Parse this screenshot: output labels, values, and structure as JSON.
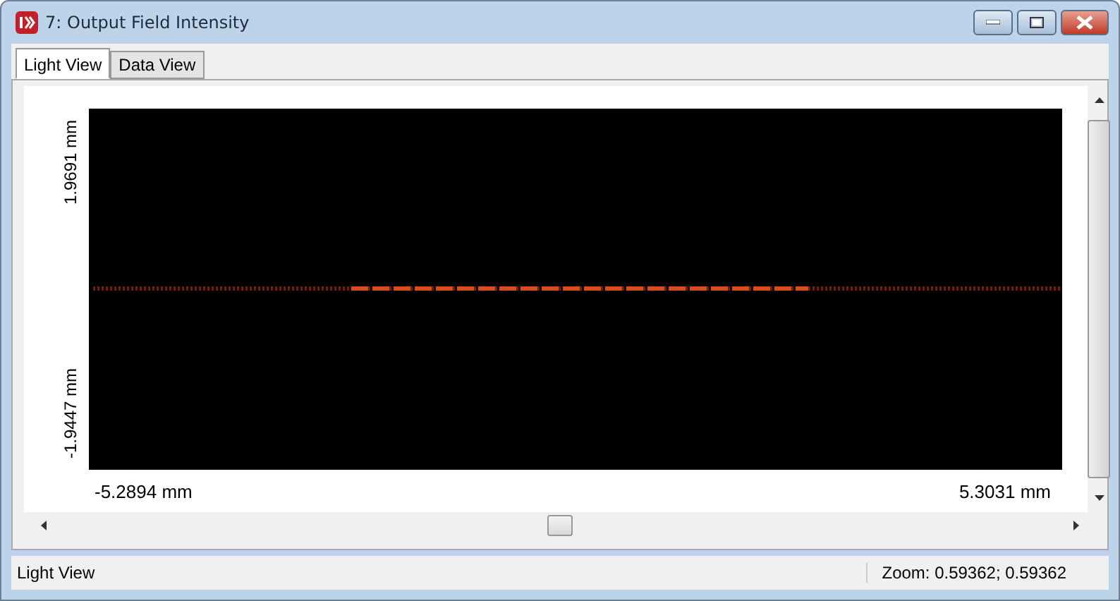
{
  "window": {
    "title": "7: Output Field Intensity"
  },
  "tabs": [
    {
      "label": "Light View",
      "selected": true
    },
    {
      "label": "Data View",
      "selected": false
    }
  ],
  "plot": {
    "y_max": "1.9691 mm",
    "y_min": "-1.9447 mm",
    "x_min": "-5.2894 mm",
    "x_max": "5.3031 mm"
  },
  "status_bar": {
    "view": "Light View",
    "zoom": "Zoom: 0.59362; 0.59362"
  }
}
